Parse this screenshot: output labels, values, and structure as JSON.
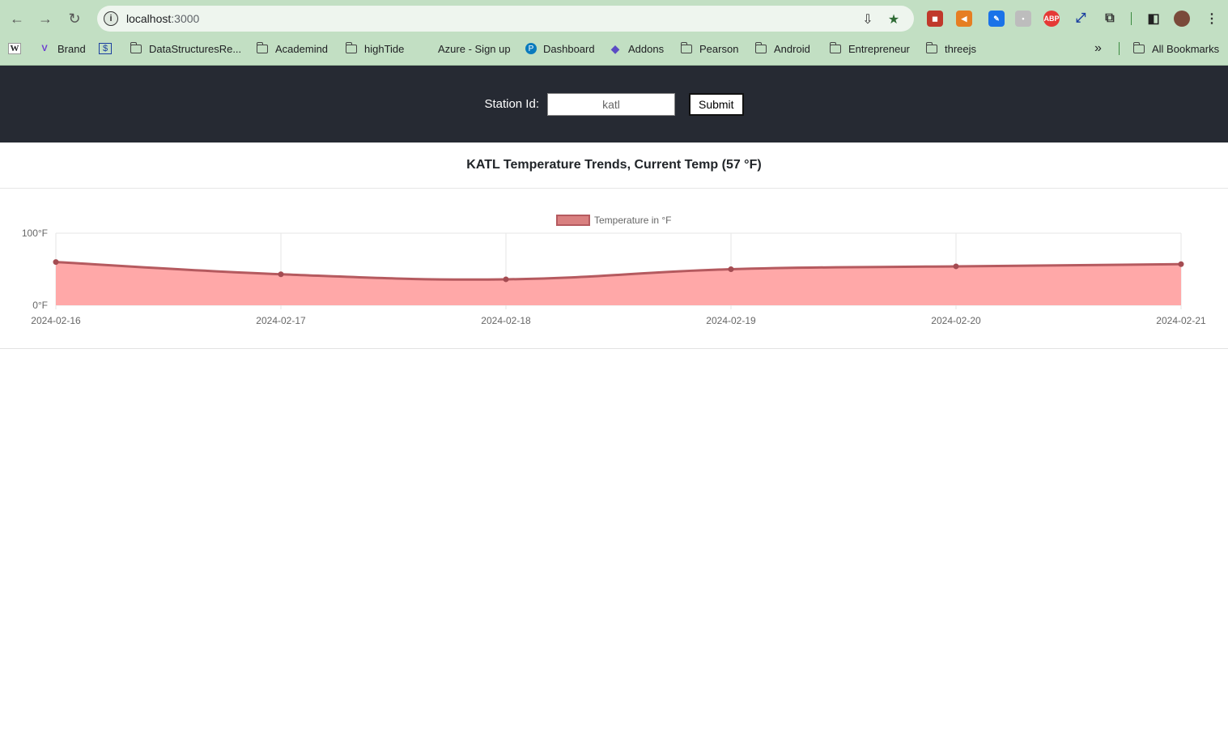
{
  "browser": {
    "url_host": "localhost",
    "url_port": ":3000",
    "bookmarks": [
      {
        "label": "",
        "icon": "wikipedia-icon"
      },
      {
        "label": "Brand",
        "icon": "vue-icon"
      },
      {
        "label": "",
        "icon": "dollar-icon"
      },
      {
        "label": "DataStructuresRe...",
        "icon": "folder-icon"
      },
      {
        "label": "Academind",
        "icon": "folder-icon"
      },
      {
        "label": "highTide",
        "icon": "folder-icon"
      },
      {
        "label": "Azure - Sign up",
        "icon": "microsoft-icon"
      },
      {
        "label": "Dashboard",
        "icon": "p-icon"
      },
      {
        "label": "Addons",
        "icon": "addons-icon"
      },
      {
        "label": "Pearson",
        "icon": "folder-icon"
      },
      {
        "label": "Android",
        "icon": "folder-icon"
      },
      {
        "label": "Entrepreneur",
        "icon": "folder-icon"
      },
      {
        "label": "threejs",
        "icon": "folder-icon"
      }
    ],
    "all_bookmarks": "All Bookmarks"
  },
  "header": {
    "station_label": "Station Id:",
    "station_value": "katl",
    "submit_label": "Submit"
  },
  "card": {
    "title": "KATL Temperature Trends, Current Temp (57 °F)"
  },
  "chart_data": {
    "type": "area",
    "x": [
      "2024-02-16",
      "2024-02-17",
      "2024-02-18",
      "2024-02-19",
      "2024-02-20",
      "2024-02-21"
    ],
    "series": [
      {
        "name": "Temperature in °F",
        "values": [
          60,
          43,
          36,
          50,
          54,
          57
        ]
      }
    ],
    "ylim": [
      0,
      100
    ],
    "yticks": [
      "0°F",
      "100°F"
    ],
    "legend": "top-center",
    "grid": true,
    "colors": {
      "line": "#b55a5f",
      "fill": "#ffa8a8",
      "point": "#a44c52"
    }
  }
}
